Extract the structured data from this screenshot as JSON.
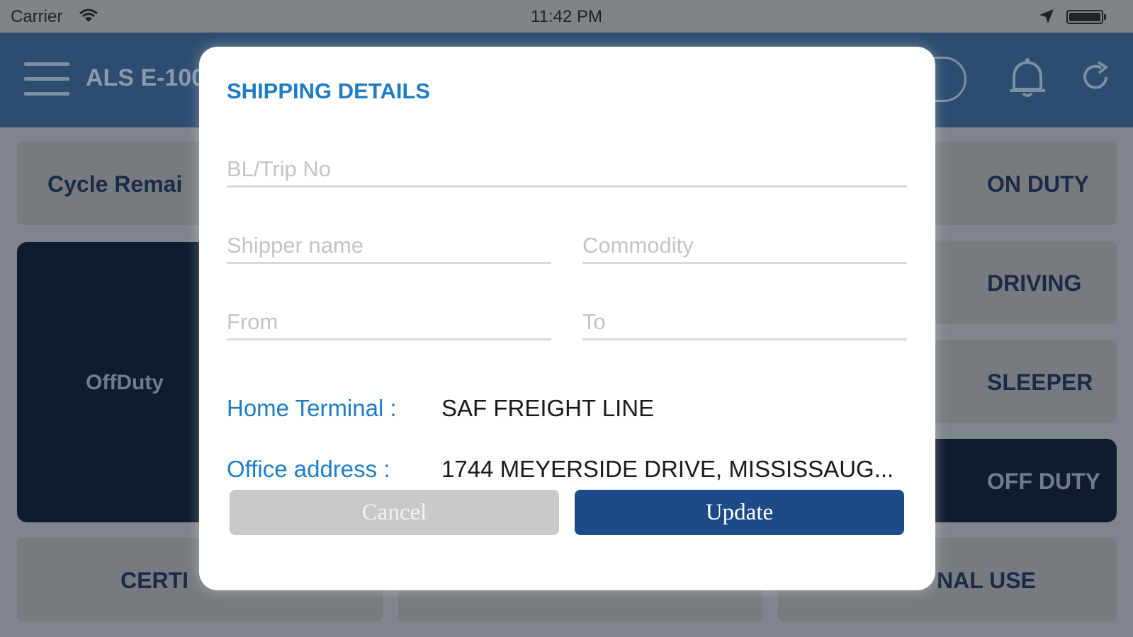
{
  "status_bar": {
    "carrier": "Carrier",
    "time": "11:42 PM",
    "icons": [
      "wifi-icon",
      "location-arrow-icon",
      "battery-icon"
    ]
  },
  "header": {
    "title": "ALS E-100",
    "icons": [
      "menu-icon",
      "bell-icon",
      "refresh-icon"
    ]
  },
  "background": {
    "cycle_label": "Cycle Remai",
    "current_status": "OffDuty",
    "duty_buttons": [
      "ON DUTY",
      "DRIVING",
      "SLEEPER",
      "OFF DUTY"
    ],
    "bottom_left": "CERTI",
    "bottom_right": "NAL USE"
  },
  "modal": {
    "title": "SHIPPING DETAILS",
    "fields": {
      "bl_trip": {
        "placeholder": "BL/Trip No",
        "value": ""
      },
      "shipper": {
        "placeholder": "Shipper name",
        "value": ""
      },
      "commodity": {
        "placeholder": "Commodity",
        "value": ""
      },
      "from": {
        "placeholder": "From",
        "value": ""
      },
      "to": {
        "placeholder": "To",
        "value": ""
      }
    },
    "home_terminal": {
      "label": "Home Terminal :",
      "value": "SAF FREIGHT LINE"
    },
    "office_address": {
      "label": "Office address :",
      "value": "1744 MEYERSIDE DRIVE, MISSISSAUG..."
    },
    "buttons": {
      "cancel": "Cancel",
      "update": "Update"
    }
  },
  "colors": {
    "accent": "#1f7cc7",
    "primary_button": "#1d4a88",
    "header": "#2c4d70"
  }
}
